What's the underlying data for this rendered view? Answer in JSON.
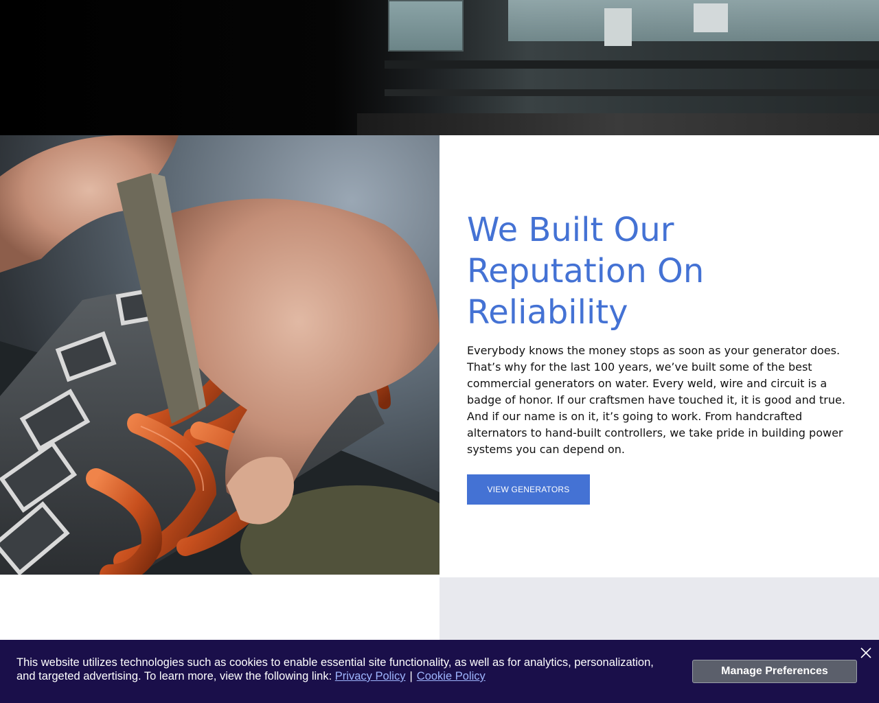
{
  "section": {
    "headline": "We Built Our Reputation On Reliability",
    "body": "Everybody knows the money stops as soon as your generator does. That’s why for the last 100 years, we’ve built some of the best commercial generators on water. Every weld, wire and circuit is a badge of honor. If our craftsmen have touched it, it is good and true. And if our name is on it, it’s going to work. From handcrafted alternators to hand-built controllers, we take pride in building power systems you can depend on.",
    "cta_label": "VIEW GENERATORS"
  },
  "cookie_banner": {
    "text_line1": "This website utilizes technologies such as cookies to enable essential site functionality, as well as for analytics, personalization,",
    "text_line2": "and targeted advertising. To learn more, view the following link: ",
    "privacy_link": "Privacy Policy",
    "separator": "|",
    "cookie_link": "Cookie Policy",
    "manage_label": "Manage Preferences",
    "close_icon": "close-icon"
  },
  "colors": {
    "accent": "#4472d4",
    "banner_bg": "#1a0f4a",
    "lower_panel_bg": "#e8e9ee"
  }
}
